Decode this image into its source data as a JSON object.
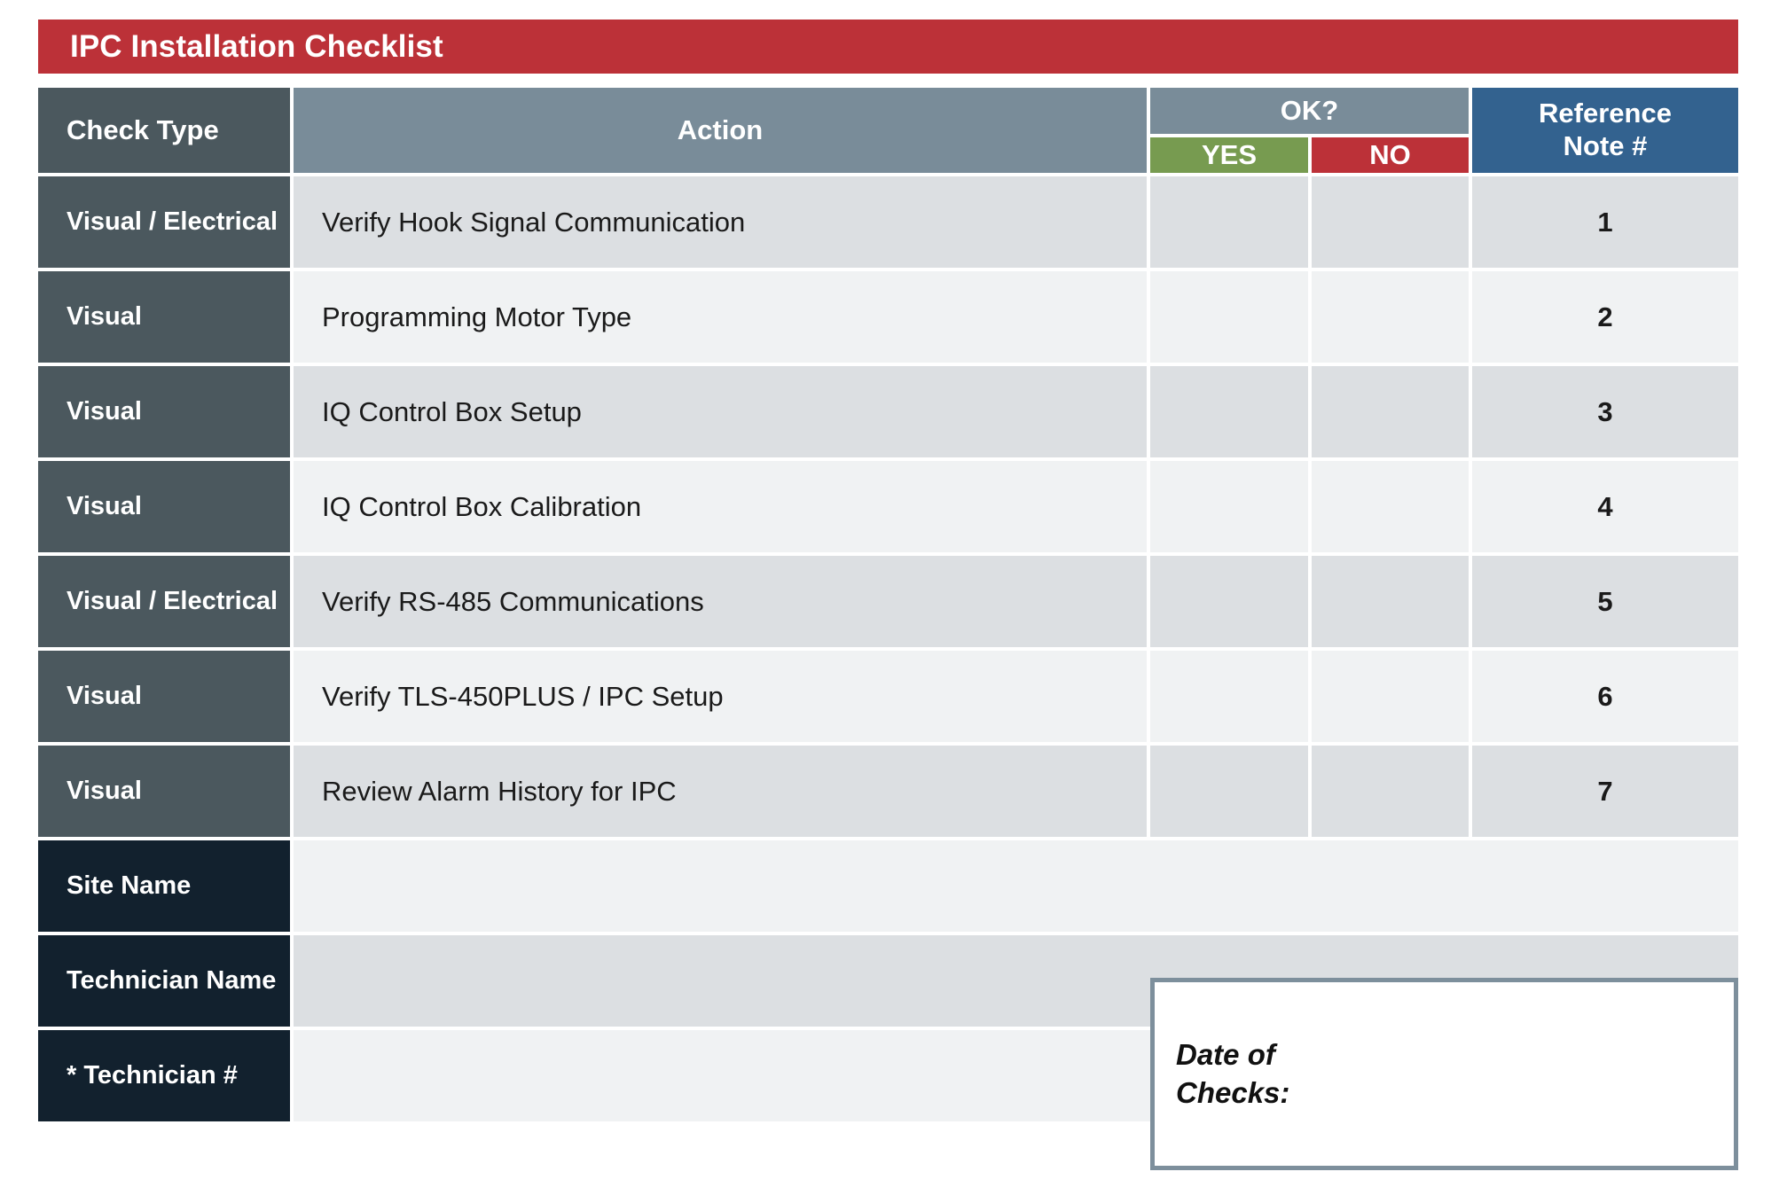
{
  "document": {
    "title": "IPC Installation Checklist"
  },
  "table": {
    "headers": {
      "check_type": "Check Type",
      "action": "Action",
      "ok_group": "OK?",
      "ok_yes": "YES",
      "ok_no": "NO",
      "reference": "Reference\nNote #",
      "reference_line1": "Reference",
      "reference_line2": "Note #"
    },
    "rows": [
      {
        "check_type": "Visual / Electrical",
        "action": "Verify Hook Signal Communication",
        "yes": "",
        "no": "",
        "reference": "1"
      },
      {
        "check_type": "Visual",
        "action": "Programming Motor Type",
        "yes": "",
        "no": "",
        "reference": "2"
      },
      {
        "check_type": "Visual",
        "action": "IQ Control Box Setup",
        "yes": "",
        "no": "",
        "reference": "3"
      },
      {
        "check_type": "Visual",
        "action": "IQ Control Box Calibration",
        "yes": "",
        "no": "",
        "reference": "4"
      },
      {
        "check_type": "Visual / Electrical",
        "action": "Verify RS-485 Communications",
        "yes": "",
        "no": "",
        "reference": "5"
      },
      {
        "check_type": "Visual",
        "action": "Verify TLS-450PLUS / IPC Setup",
        "yes": "",
        "no": "",
        "reference": "6"
      },
      {
        "check_type": "Visual",
        "action": "Review Alarm History for IPC",
        "yes": "",
        "no": "",
        "reference": "7"
      }
    ],
    "footer_fields": [
      {
        "label": "Site Name",
        "value": ""
      },
      {
        "label": "Technician Name",
        "value": ""
      },
      {
        "label": "* Technician #",
        "value": ""
      }
    ]
  },
  "date_box": {
    "label": "Date of\nChecks:",
    "value": ""
  },
  "colors": {
    "title_red": "#bc3138",
    "header_dark": "#4b585e",
    "header_slate": "#798c99",
    "yes_green": "#779b50",
    "no_red": "#bc3138",
    "reference_blue": "#33628f",
    "footer_navy": "#12212e",
    "band_a": "#dcdfe2",
    "band_b": "#f0f2f3",
    "date_box_border": "#7d8f9c"
  }
}
